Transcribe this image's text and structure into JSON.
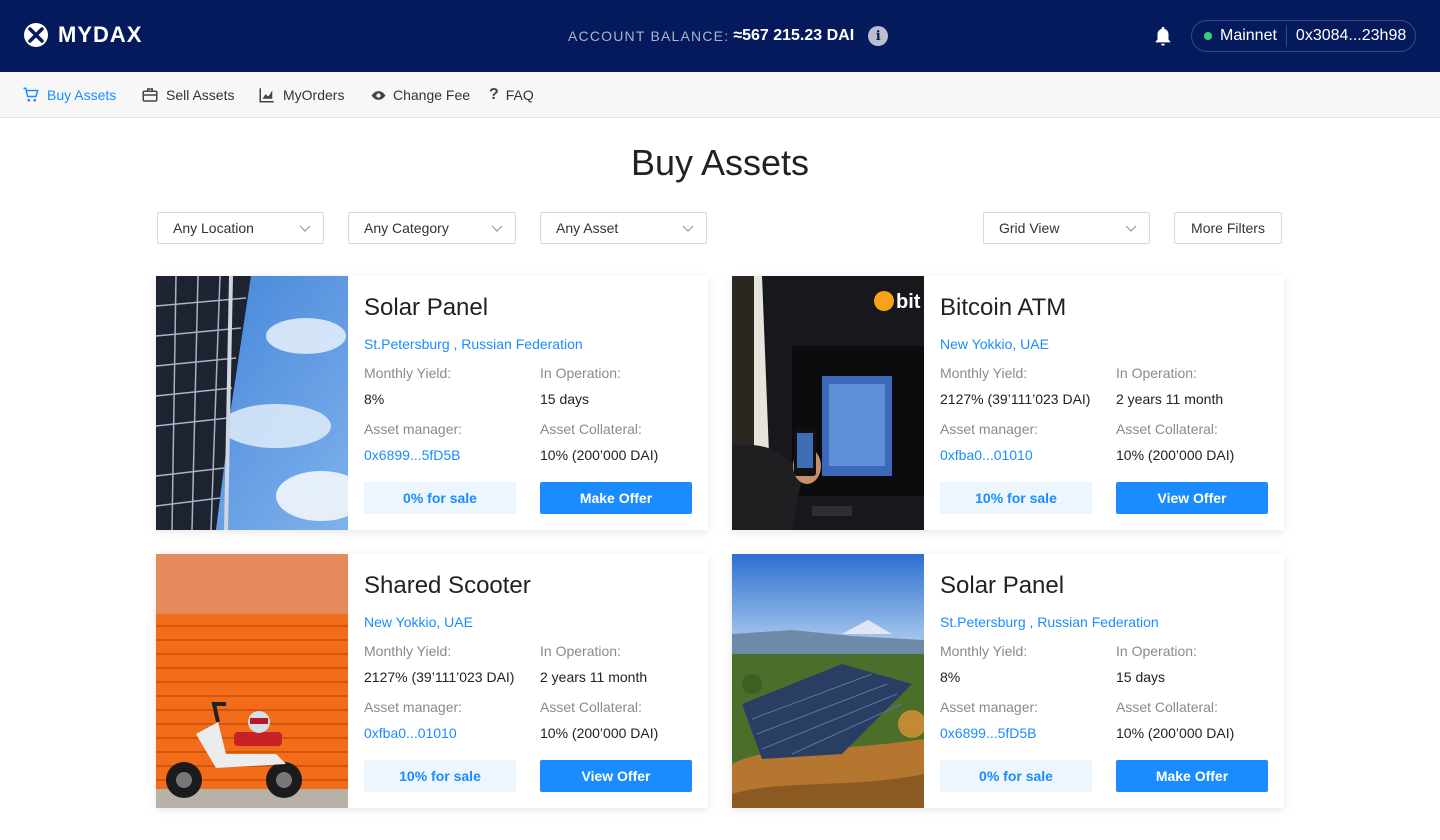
{
  "header": {
    "logo_text": "MYDAX",
    "balance_label": "ACCOUNT BALANCE:",
    "balance_value": "≈567 215.23 DAI",
    "network": "Mainnet",
    "address": "0x3084...23h98"
  },
  "nav": {
    "items": [
      {
        "label": "Buy Assets",
        "icon": "cart-icon"
      },
      {
        "label": "Sell Assets",
        "icon": "briefcase-icon"
      },
      {
        "label": "MyOrders",
        "icon": "chart-icon"
      },
      {
        "label": "Change Fee",
        "icon": "eye-icon"
      },
      {
        "label": "FAQ",
        "icon": "question-icon"
      }
    ]
  },
  "page": {
    "title": "Buy Assets"
  },
  "filters": {
    "location": "Any Location",
    "category": "Any Category",
    "asset": "Any Asset",
    "view": "Grid View",
    "more": "More Filters"
  },
  "labels": {
    "yield": "Monthly Yield:",
    "operation": "In Operation:",
    "manager": "Asset manager:",
    "collateral": "Asset Collateral:"
  },
  "cards": [
    {
      "title": "Solar Panel",
      "location": "St.Petersburg , Russian Federation",
      "yield": "8%",
      "operation": "15 days",
      "manager": "0x6899...5fD5B",
      "collateral": "10% (200’000 DAI)",
      "sale": "0% for sale",
      "action": "Make Offer",
      "image": "solar-panel-photo"
    },
    {
      "title": "Bitcoin ATM",
      "location": "New Yokkio, UAE",
      "yield": "2127% (39’111’023 DAI)",
      "operation": "2 years 11 month",
      "manager": "0xfba0...01010",
      "collateral": "10% (200’000 DAI)",
      "sale": "10% for sale",
      "action": "View Offer",
      "image": "bitcoin-atm-photo"
    },
    {
      "title": "Shared Scooter",
      "location": "New Yokkio, UAE",
      "yield": "2127% (39’111’023 DAI)",
      "operation": "2 years 11 month",
      "manager": "0xfba0...01010",
      "collateral": "10% (200’000 DAI)",
      "sale": "10% for sale",
      "action": "View Offer",
      "image": "scooter-photo"
    },
    {
      "title": "Solar Panel",
      "location": "St.Petersburg , Russian Federation",
      "yield": "8%",
      "operation": "15 days",
      "manager": "0x6899...5fD5B",
      "collateral": "10% (200’000 DAI)",
      "sale": "0% for sale",
      "action": "Make Offer",
      "image": "solar-farm-photo"
    }
  ],
  "colors": {
    "header_bg": "#051a5c",
    "accent": "#1a8cff",
    "network_status": "#33d27a"
  }
}
